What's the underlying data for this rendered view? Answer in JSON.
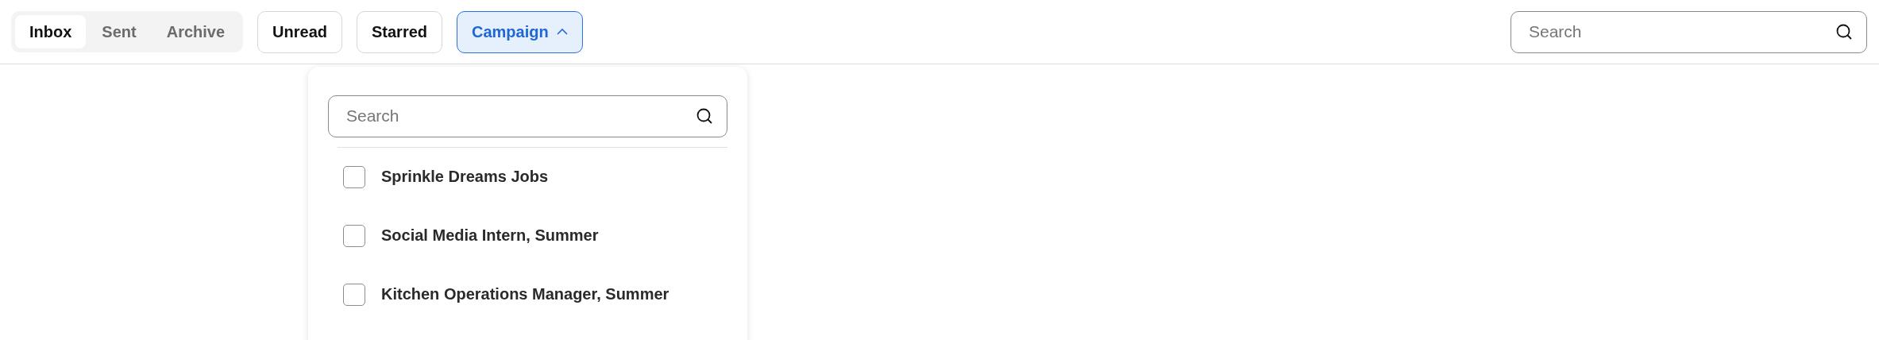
{
  "tabs": [
    {
      "label": "Inbox",
      "selected": true
    },
    {
      "label": "Sent",
      "selected": false
    },
    {
      "label": "Archive",
      "selected": false
    }
  ],
  "filters": [
    {
      "label": "Unread",
      "kind": "toggle"
    },
    {
      "label": "Starred",
      "kind": "toggle"
    },
    {
      "label": "Campaign",
      "kind": "dropdown",
      "expanded": true
    }
  ],
  "campaign_menu": {
    "search": {
      "placeholder": "Search"
    },
    "options": [
      {
        "label": "Sprinkle Dreams Jobs",
        "checked": false
      },
      {
        "label": "Social Media Intern, Summer",
        "checked": false
      },
      {
        "label": "Kitchen Operations Manager, Summer",
        "checked": false
      }
    ]
  },
  "search": {
    "placeholder": "Search"
  }
}
